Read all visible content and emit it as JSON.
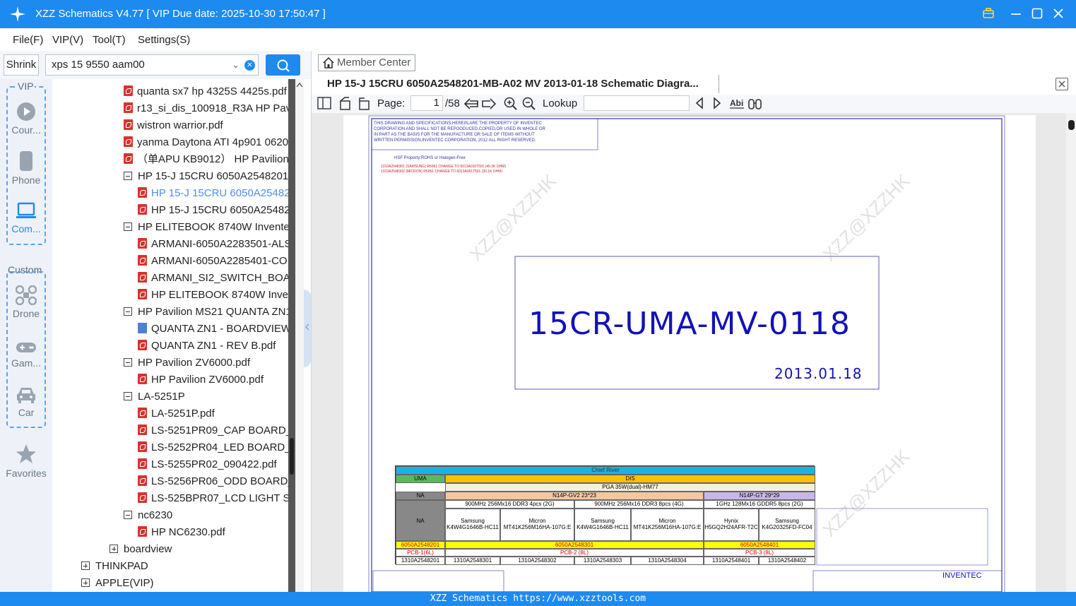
{
  "titlebar": {
    "title": "XZZ Schematics V4.77 [ VIP Due date: 2025-10-30 17:50:47 ]"
  },
  "menu": {
    "file": "File(F)",
    "vip": "VIP(V)",
    "tool": "Tool(T)",
    "settings": "Settings(S)"
  },
  "search": {
    "shrink_label": "Shrink",
    "query": "xps 15 9550 aam00"
  },
  "sidebar": {
    "vip_label": "VIP",
    "items": [
      {
        "label": "Cour..."
      },
      {
        "label": "Phone"
      },
      {
        "label": "Com..."
      },
      {
        "label": "Drone"
      },
      {
        "label": "Gam..."
      },
      {
        "label": "Car"
      },
      {
        "label": "Favorites"
      }
    ],
    "custom_label": "Custom"
  },
  "tree": [
    {
      "label": "quanta sx7 hp 4325S 4425s.pdf",
      "type": "pdf"
    },
    {
      "label": "r13_si_dis_100918_R3A HP Pavili",
      "type": "pdf"
    },
    {
      "label": "wistron warrior.pdf",
      "type": "pdf"
    },
    {
      "label": "yanma Daytona ATI 4p901 0620",
      "type": "pdf"
    },
    {
      "label": "（单APU KB9012） HP Pavilion",
      "type": "pdf"
    },
    {
      "label": "HP 15-J 15CRU 6050A2548201-I",
      "type": "folder-open"
    },
    {
      "label": "HP 15-J 15CRU 6050A254820",
      "type": "pdf",
      "selected": true
    },
    {
      "label": "HP 15-J 15CRU 6050A254820",
      "type": "pdf"
    },
    {
      "label": "HP ELITEBOOK 8740W Inventec",
      "type": "folder-open"
    },
    {
      "label": "ARMANI-6050A2283501-ALS",
      "type": "pdf"
    },
    {
      "label": "ARMANI-6050A2285401-COI",
      "type": "pdf"
    },
    {
      "label": "ARMANI_SI2_SWITCH_BOARI",
      "type": "pdf"
    },
    {
      "label": "HP ELITEBOOK 8740W Inven",
      "type": "pdf"
    },
    {
      "label": "HP Pavilion MS21 QUANTA ZN1",
      "type": "folder-open"
    },
    {
      "label": "QUANTA ZN1 - BOARDVIEW",
      "type": "boardview"
    },
    {
      "label": "QUANTA ZN1 - REV B.pdf",
      "type": "pdf"
    },
    {
      "label": "HP Pavilion ZV6000.pdf",
      "type": "folder-open"
    },
    {
      "label": "HP Pavilion ZV6000.pdf",
      "type": "pdf"
    },
    {
      "label": "LA-5251P",
      "type": "folder-open"
    },
    {
      "label": "LA-5251P.pdf",
      "type": "pdf"
    },
    {
      "label": "LS-5251PR09_CAP BOARD_SI",
      "type": "pdf"
    },
    {
      "label": "LS-5252PR04_LED BOARD_0S",
      "type": "pdf"
    },
    {
      "label": "LS-5255PR02_090422.pdf",
      "type": "pdf"
    },
    {
      "label": "LS-5256PR06_ODD BOARD_C",
      "type": "pdf"
    },
    {
      "label": "LS-525BPR07_LCD LIGHT SEN",
      "type": "pdf"
    },
    {
      "label": "nc6230",
      "type": "folder-open"
    },
    {
      "label": "HP NC6230.pdf",
      "type": "pdf"
    },
    {
      "label": "boardview",
      "type": "folder-closed"
    },
    {
      "label": "THINKPAD",
      "type": "folder-closed"
    },
    {
      "label": "APPLE(VIP)",
      "type": "folder-closed"
    }
  ],
  "viewer": {
    "member_center": "Member Center",
    "doc_title": "HP 15-J 15CRU 6050A2548201-MB-A02 MV 2013-01-18 Schematic Diagra...",
    "page_label": "Page:",
    "page_current": "1",
    "page_total": "/58",
    "lookup_label": "Lookup"
  },
  "schematic": {
    "notice": [
      "THIS DRAWING AND SPECIFICATIONS,HEREIN,ARE THE PROPERTY OF INVENTEC",
      "CORPORATION AND SHALL NOT BE REPOODUCED,COPIED,OR USED IN WHOLE OR",
      "IN PART AS THE BASIS FOR THE MANUFACTURE OR SALE OF ITEMS WITHOUT",
      "WRITTEN PERMISSION,INVENTEC CORPORATION,  2012   ALL RIGHT RESERVED."
    ],
    "hsf": "HSF Property:ROHS or  Halogen-Free",
    "red_notes": [
      "1310A2548301 (SAMSUNG)   R5061 CHANGE TO 6013A0107501 (45.3K OHM)",
      "1310A2548302 (MICRON)    R5061 CHANGE TO 6013A0017501 (30.1K OHM)"
    ],
    "main_title": "15CR-UMA-MV-0118",
    "date": "2013.01.18",
    "watermark": "XZZ@XZZHK",
    "company": "INVENTEC",
    "table": {
      "header": "Chief River",
      "uma": "UMA",
      "dis": "DIS",
      "pga": "PGA 35W(dual)-HM77",
      "na": "NA",
      "gpu1": "N14P-GV2 23*23",
      "gpu2": "N14P-GT 29*29",
      "mem1": "900MHz 256Mx16 DDR3 4pcs (2G)",
      "mem2": "900MHz 256Mx16 DDR3 8pcs (4G)",
      "mem3": "1GHz 128Mx16 GDDR5 8pcs (2G)",
      "vendors": [
        "Samsung",
        "Micron",
        "Samsung",
        "Micron",
        "Hynix",
        "Samsung"
      ],
      "parts": [
        "K4W4G1646B-HC11",
        "MT41K256M16HA-107G:E",
        "K4W4G1646B-HC11",
        "MT41K256M16HA-107G:E",
        "H5GQ2H24AFR-T2C",
        "K4G20325FD-FC04"
      ],
      "pn1": "6050A2548201",
      "pn2": "6050A2548301",
      "pn3": "6050A2548401",
      "pcb1": "PCB-1(6L)",
      "pcb2": "PCB-2 (8L)",
      "pcb3": "PCB-3 (8L)",
      "codes": [
        "1310A2548201",
        "1310A2548301",
        "1310A2548302",
        "1310A2548303",
        "1310A2548304",
        "1310A2548401",
        "1310A2548402"
      ]
    }
  },
  "status": {
    "text": "XZZ Schematics https://www.xzztools.com"
  }
}
